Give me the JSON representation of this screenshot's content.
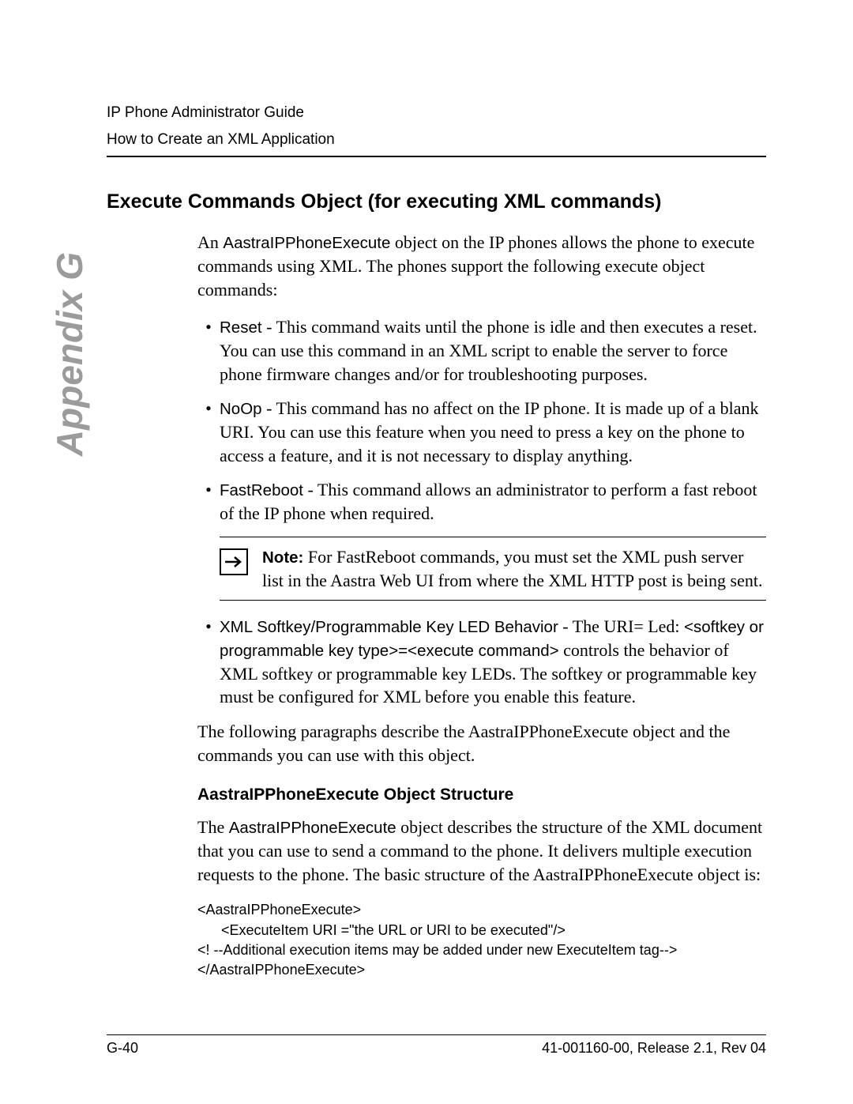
{
  "header": {
    "line1": "IP Phone Administrator Guide",
    "line2": "How to Create an XML Application"
  },
  "sidebar_label": "Appendix G",
  "section_title": "Execute Commands Object (for executing XML commands)",
  "intro": {
    "prefix": "An ",
    "object_name": "AastraIPPhoneExecute",
    "rest": " object on the IP phones allows the phone to execute commands using XML. The phones support the following execute object commands:"
  },
  "bullets": [
    {
      "term": "Reset",
      "sep": " - ",
      "text": "This command waits until the phone is idle and then executes a reset. You can use this command in an XML script to enable the server to force phone firmware changes and/or for troubleshooting purposes."
    },
    {
      "term": "NoOp",
      "sep": " - ",
      "text": "This command has no affect on the IP phone. It is made up of a blank URI. You can use this feature when you need to press a key on the phone to access a feature, and it is not necessary to display anything."
    },
    {
      "term": "FastReboot",
      "sep": " - ",
      "text": "This command allows an administrator to perform a fast reboot of the IP phone when required."
    }
  ],
  "note": {
    "label": "Note:",
    "text": " For FastReboot commands, you must set the XML push server list in the Aastra Web UI from where the XML HTTP post is being sent."
  },
  "bullet_led": {
    "term": "XML Softkey/Programmable Key LED Behavior",
    "sep": " - ",
    "lead": "The URI= Led: ",
    "code": "<softkey or programmable key type>=<execute command>",
    "rest": " controls the behavior of XML softkey or programmable key LEDs. The softkey or programmable key must be configured for XML before you enable this feature."
  },
  "closing_para": "The following paragraphs describe the AastraIPPhoneExecute object and the commands you can use with this object.",
  "subheading": "AastraIPPhoneExecute Object Structure",
  "struct_para": {
    "prefix": "The ",
    "object_name": "AastraIPPhoneExecute",
    "rest": " object describes the structure of the XML document that you can use to send a command to the phone. It delivers multiple execution requests to the phone. The basic structure of the AastraIPPhoneExecute object is:"
  },
  "code_lines": [
    "<AastraIPPhoneExecute>",
    "      <ExecuteItem URI =\"the URL or URI to be executed\"/>",
    "<! --Additional execution items may be added under new ExecuteItem tag-->",
    "</AastraIPPhoneExecute>"
  ],
  "footer": {
    "left": "G-40",
    "right": "41-001160-00, Release 2.1, Rev 04"
  }
}
